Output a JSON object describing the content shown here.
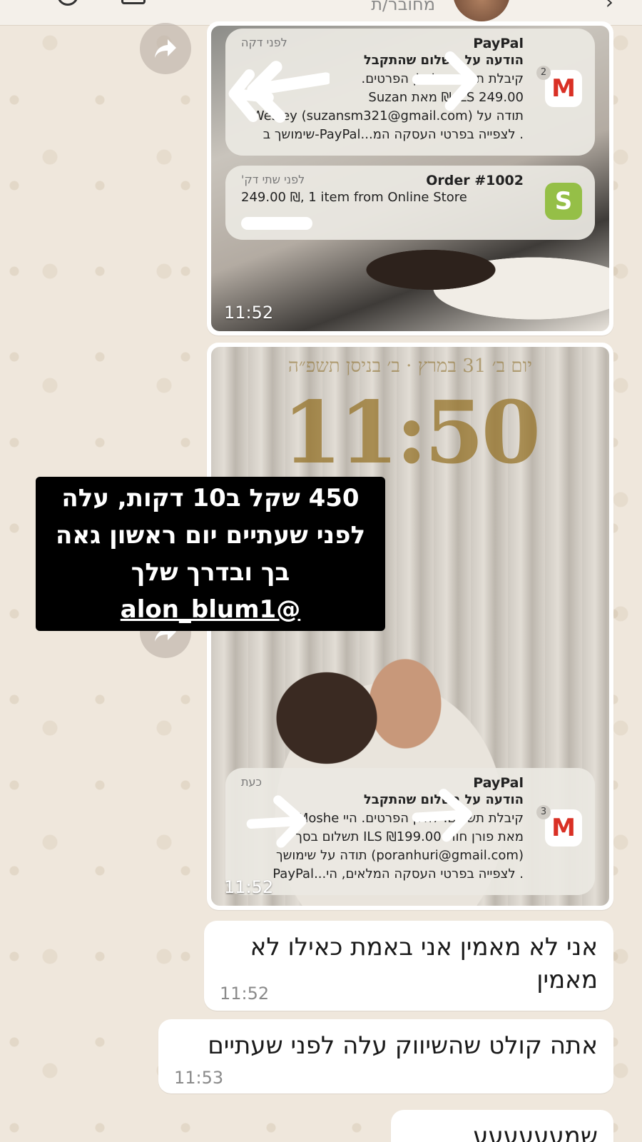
{
  "header": {
    "contact_status": "מחובר/ת"
  },
  "media_1": {
    "notification_paypal": {
      "app": "PayPal",
      "time_ago": "לפני דקה",
      "badge": "2",
      "line1": "הודעה על תשלום שהתקבל",
      "line2": "קיבלת תשלום. להלן הפרטים.",
      "line3": "249.00 ILS ₪ מאת Suzan",
      "line4": "תודה על (suzansm321@gmail.com) Wesley",
      "line5": ". לצפייה בפרטי העסקה המ...PayPal-שימושך ב"
    },
    "notification_shopify": {
      "app": "Order #1002",
      "time_ago": "לפני שתי דק'",
      "line1": "249.00 ₪, 1 item from Online Store"
    },
    "time": "11:52"
  },
  "media_2": {
    "lock_date": "יום ב׳ 31 במרץ · ב׳ בניסן תשפ״ה",
    "lock_clock": "11:50",
    "story_text_line1": "450 שקל ב10 דקות, עלה",
    "story_text_line2": "לפני שעתיים יום ראשון גאה",
    "story_text_line3": "בך ובדרך שלך",
    "story_handle": "alon_blum1@",
    "notification_paypal": {
      "app": "PayPal",
      "time_ago": "כעת",
      "badge": "3",
      "line1": "הודעה על תשלום שהתקבל",
      "line2": "קיבלת תשלום. להלן הפרטים. היי Moshe",
      "line3": "מאת פורן חורי ₪199.00 ILS תשלום בסך",
      "line4": "(poranhuri@gmail.com) תודה על שימושך",
      "line5": ". לצפייה בפרטי העסקה המלאים, הי...PayPal"
    },
    "time": "11:52"
  },
  "messages": [
    {
      "text": "אני לא מאמין אני באמת כאילו לא מאמין",
      "time": "11:52"
    },
    {
      "text": "אתה קולט שהשיווק עלה לפני שעתיים",
      "time": "11:53"
    },
    {
      "text": "שמעעעעעע",
      "time": ""
    }
  ],
  "colors": {
    "wallpaper": "#efe7dc",
    "bubble": "#ffffff",
    "gmail_red": "#d93025",
    "shopify_green": "#95bf47"
  }
}
